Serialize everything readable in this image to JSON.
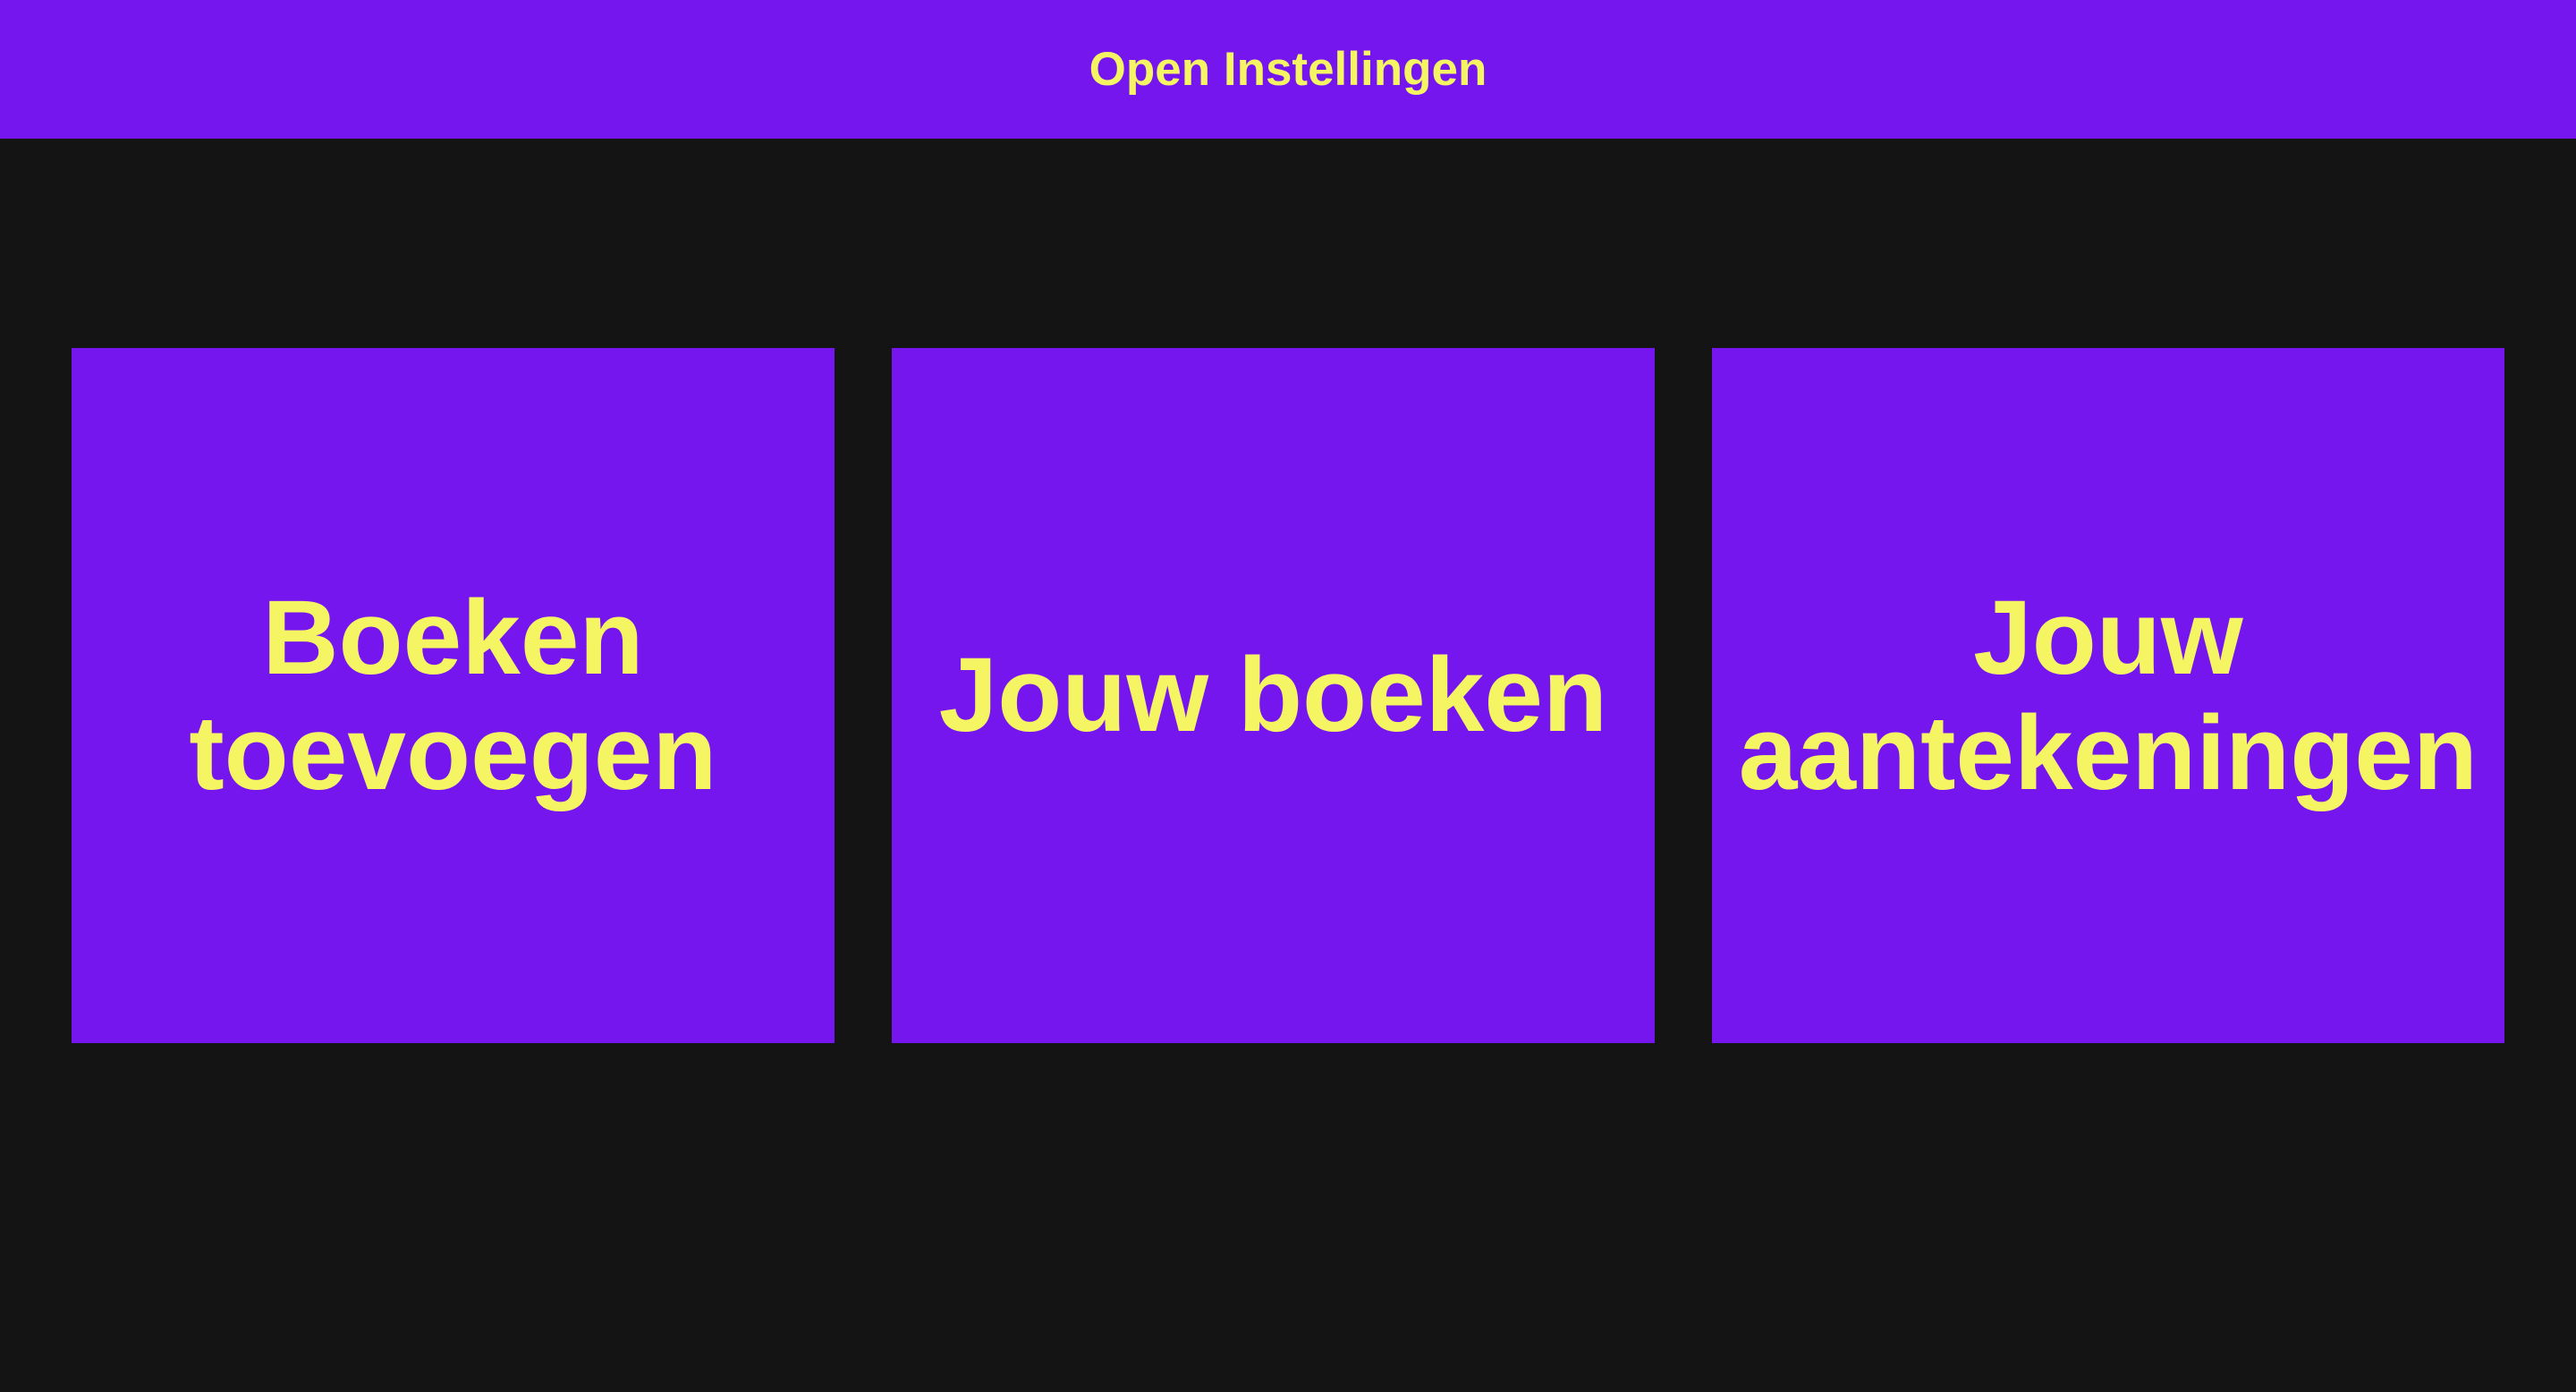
{
  "colors": {
    "background": "#141414",
    "accent": "#7516ef",
    "text": "#f5f564"
  },
  "header": {
    "settings_button_label": "Open Instellingen"
  },
  "tiles": [
    {
      "label": "Boeken toevoegen"
    },
    {
      "label": "Jouw boeken"
    },
    {
      "label": "Jouw aantekeningen"
    }
  ]
}
